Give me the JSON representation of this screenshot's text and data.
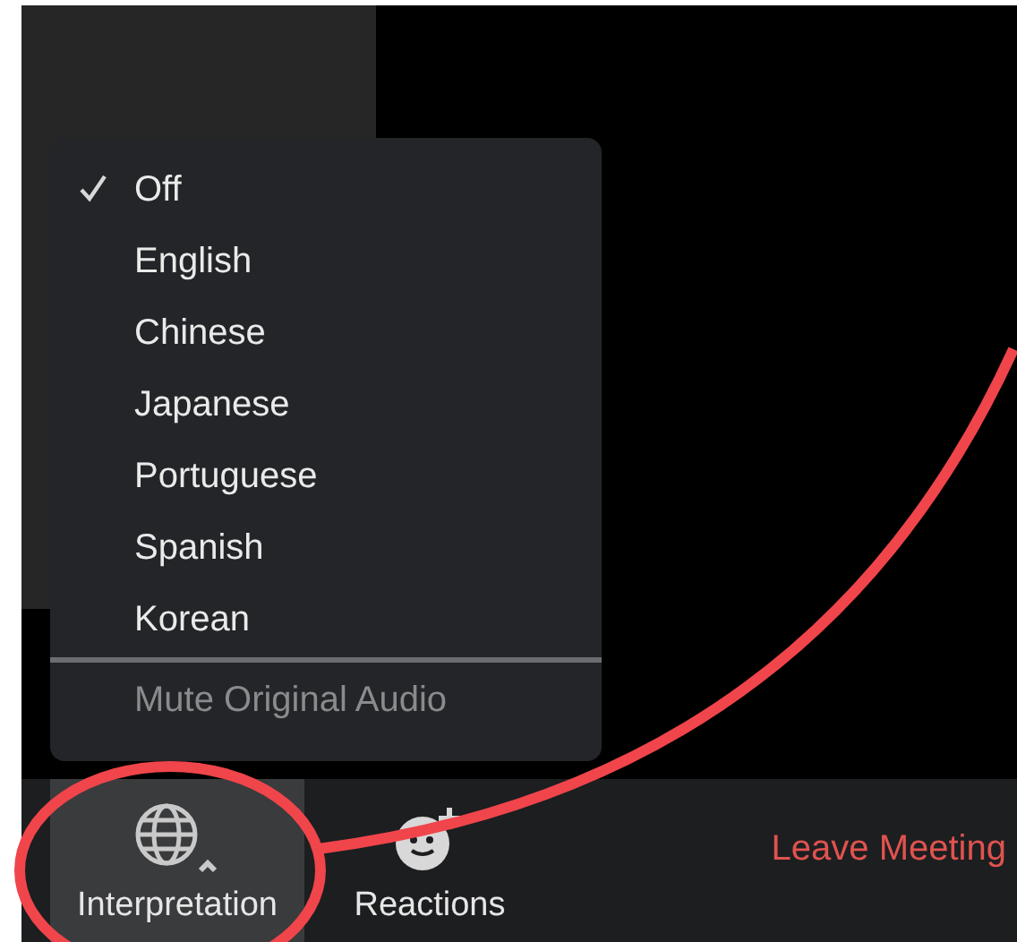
{
  "interpretation_menu": {
    "languages": [
      {
        "label": "Off",
        "selected": true
      },
      {
        "label": "English",
        "selected": false
      },
      {
        "label": "Chinese",
        "selected": false
      },
      {
        "label": "Japanese",
        "selected": false
      },
      {
        "label": "Portuguese",
        "selected": false
      },
      {
        "label": "Spanish",
        "selected": false
      },
      {
        "label": "Korean",
        "selected": false
      }
    ],
    "mute_option": {
      "label": "Mute Original Audio",
      "disabled": true
    }
  },
  "toolbar": {
    "buttons": [
      {
        "kind": "globe",
        "label": "Interpretation",
        "active": true
      },
      {
        "kind": "reactions",
        "label": "Reactions",
        "active": false
      }
    ],
    "leave": "Leave Meeting"
  }
}
